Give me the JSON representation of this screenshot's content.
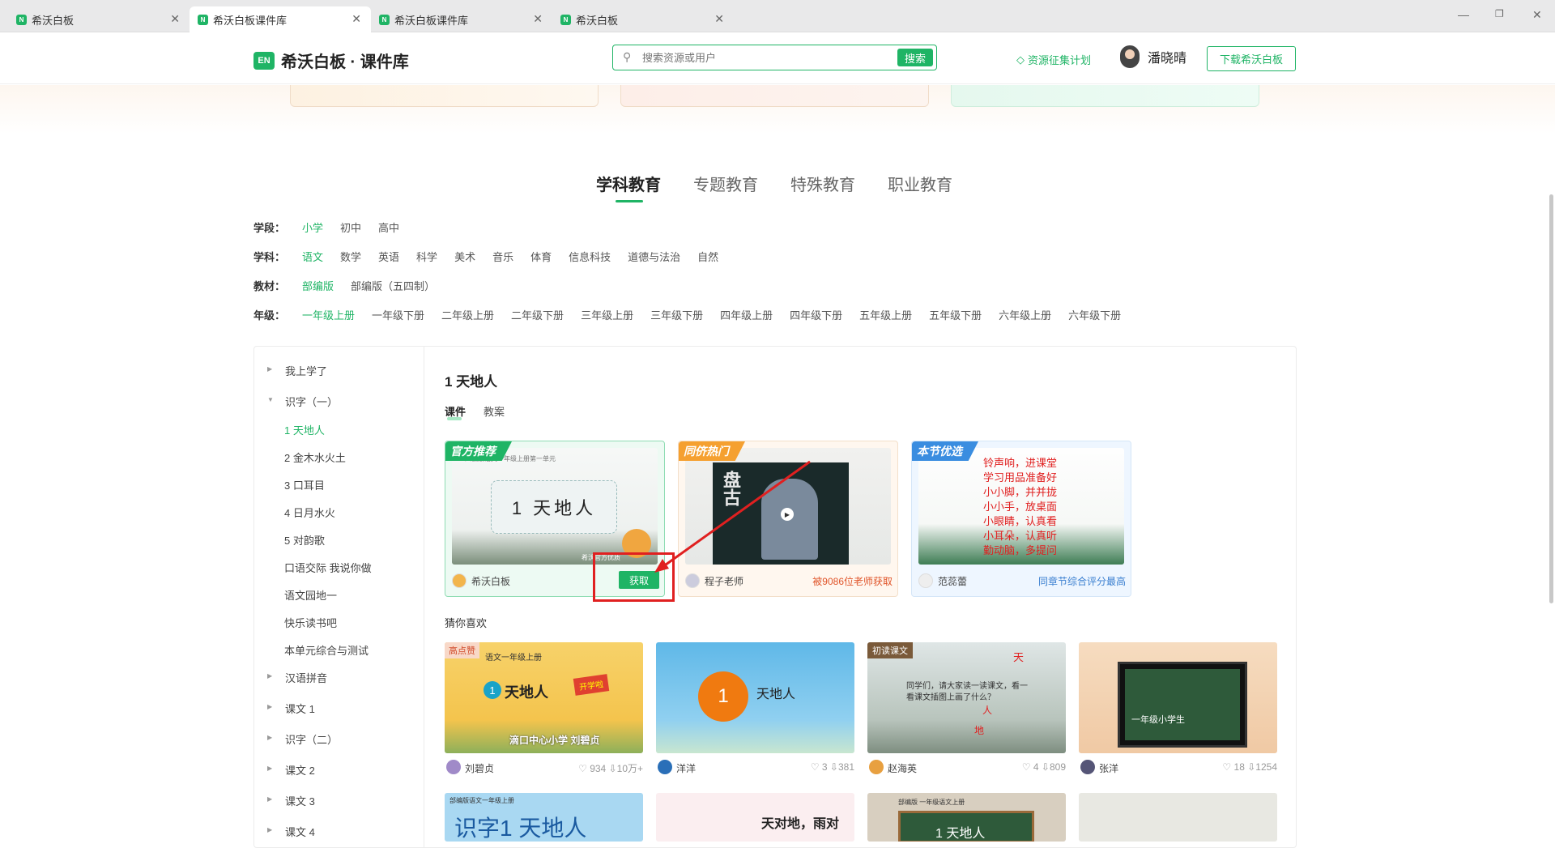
{
  "tabs": [
    {
      "title": "希沃白板",
      "active": false
    },
    {
      "title": "希沃白板课件库",
      "active": true
    },
    {
      "title": "希沃白板课件库",
      "active": false
    },
    {
      "title": "希沃白板",
      "active": false
    }
  ],
  "header": {
    "logo_mark": "EN",
    "logo_text": "希沃白板 · 课件库",
    "search_placeholder": "搜索资源或用户",
    "search_button": "搜索",
    "plan_link": "资源征集计划",
    "user_name": "潘晓晴",
    "download_button": "下载希沃白板"
  },
  "category_tabs": [
    "学科教育",
    "专题教育",
    "特殊教育",
    "职业教育"
  ],
  "filters": [
    {
      "label": "学段：",
      "options": [
        "小学",
        "初中",
        "高中"
      ],
      "selected": 0
    },
    {
      "label": "学科：",
      "options": [
        "语文",
        "数学",
        "英语",
        "科学",
        "美术",
        "音乐",
        "体育",
        "信息科技",
        "道德与法治",
        "自然"
      ],
      "selected": 0
    },
    {
      "label": "教材：",
      "options": [
        "部编版",
        "部编版（五四制）"
      ],
      "selected": 0
    },
    {
      "label": "年级：",
      "options": [
        "一年级上册",
        "一年级下册",
        "二年级上册",
        "二年级下册",
        "三年级上册",
        "三年级下册",
        "四年级上册",
        "四年级下册",
        "五年级上册",
        "五年级下册",
        "六年级上册",
        "六年级下册"
      ],
      "selected": 0
    }
  ],
  "sidebar": [
    {
      "label": "我上学了",
      "type": "collapsed"
    },
    {
      "label": "识字（一）",
      "type": "expanded"
    },
    {
      "label": "1 天地人",
      "type": "sub",
      "selected": true
    },
    {
      "label": "2 金木水火土",
      "type": "sub"
    },
    {
      "label": "3 口耳目",
      "type": "sub"
    },
    {
      "label": "4 日月水火",
      "type": "sub"
    },
    {
      "label": "5 对韵歌",
      "type": "sub"
    },
    {
      "label": "口语交际 我说你做",
      "type": "sub"
    },
    {
      "label": "语文园地一",
      "type": "sub"
    },
    {
      "label": "快乐读书吧",
      "type": "sub"
    },
    {
      "label": "本单元综合与测试",
      "type": "sub"
    },
    {
      "label": "汉语拼音",
      "type": "collapsed"
    },
    {
      "label": "课文 1",
      "type": "collapsed"
    },
    {
      "label": "识字（二）",
      "type": "collapsed"
    },
    {
      "label": "课文 2",
      "type": "collapsed"
    },
    {
      "label": "课文 3",
      "type": "collapsed"
    },
    {
      "label": "课文 4",
      "type": "collapsed"
    }
  ],
  "main": {
    "title": "1 天地人",
    "tabs": [
      "课件",
      "教案"
    ],
    "featured": [
      {
        "badge": "官方推荐",
        "thumb_text": "1 天地人",
        "thumb_header": "人教版语文一年级上册第一单元",
        "author": "希沃白板",
        "action": "获取",
        "corner": "希沃官方优质"
      },
      {
        "badge": "同侪热门",
        "thumb_text": "盘古",
        "author": "程子老师",
        "stat": "被9086位老师获取"
      },
      {
        "badge": "本节优选",
        "poem": [
          "铃声响，进课堂",
          "学习用品准备好",
          "小小脚，并并拢",
          "小小手，放桌面",
          "小眼睛，认真看",
          "小耳朵，认真听",
          "勤动脑，多提问"
        ],
        "author": "范蕊蕾",
        "stat": "同章节综合评分最高"
      }
    ],
    "guess_title": "猜你喜欢",
    "guess": [
      {
        "tag": "高点赞",
        "thumb_title": "语文一年级上册",
        "thumb_text": "天地人",
        "thumb_num": "1",
        "thumb_sub": "滴口中心小学 刘碧贞",
        "flag": "开学啦",
        "author": "刘碧贞",
        "likes": "934",
        "downloads": "10万+"
      },
      {
        "thumb_num": "1",
        "thumb_text": "天地人",
        "author": "洋洋",
        "likes": "3",
        "downloads": "381"
      },
      {
        "tag": "初读课文",
        "thumb_text": "同学们，请大家读一读课文，看一看课文插图上画了什么？",
        "chars": [
          "天",
          "人",
          "地"
        ],
        "author": "赵海英",
        "likes": "4",
        "downloads": "809"
      },
      {
        "thumb_text": "一年级小学生",
        "author": "张洋",
        "likes": "18",
        "downloads": "1254"
      }
    ],
    "guess_row2": [
      {
        "header": "部编版语文一年级上册",
        "text": "识字1 天地人"
      },
      {
        "text": "天对地，雨对"
      },
      {
        "header": "部编版 一年级语文上册",
        "text": "1 天地人"
      },
      {
        "text": ""
      }
    ]
  },
  "colors": {
    "accent": "#1fb465",
    "annotation": "#e02020"
  }
}
